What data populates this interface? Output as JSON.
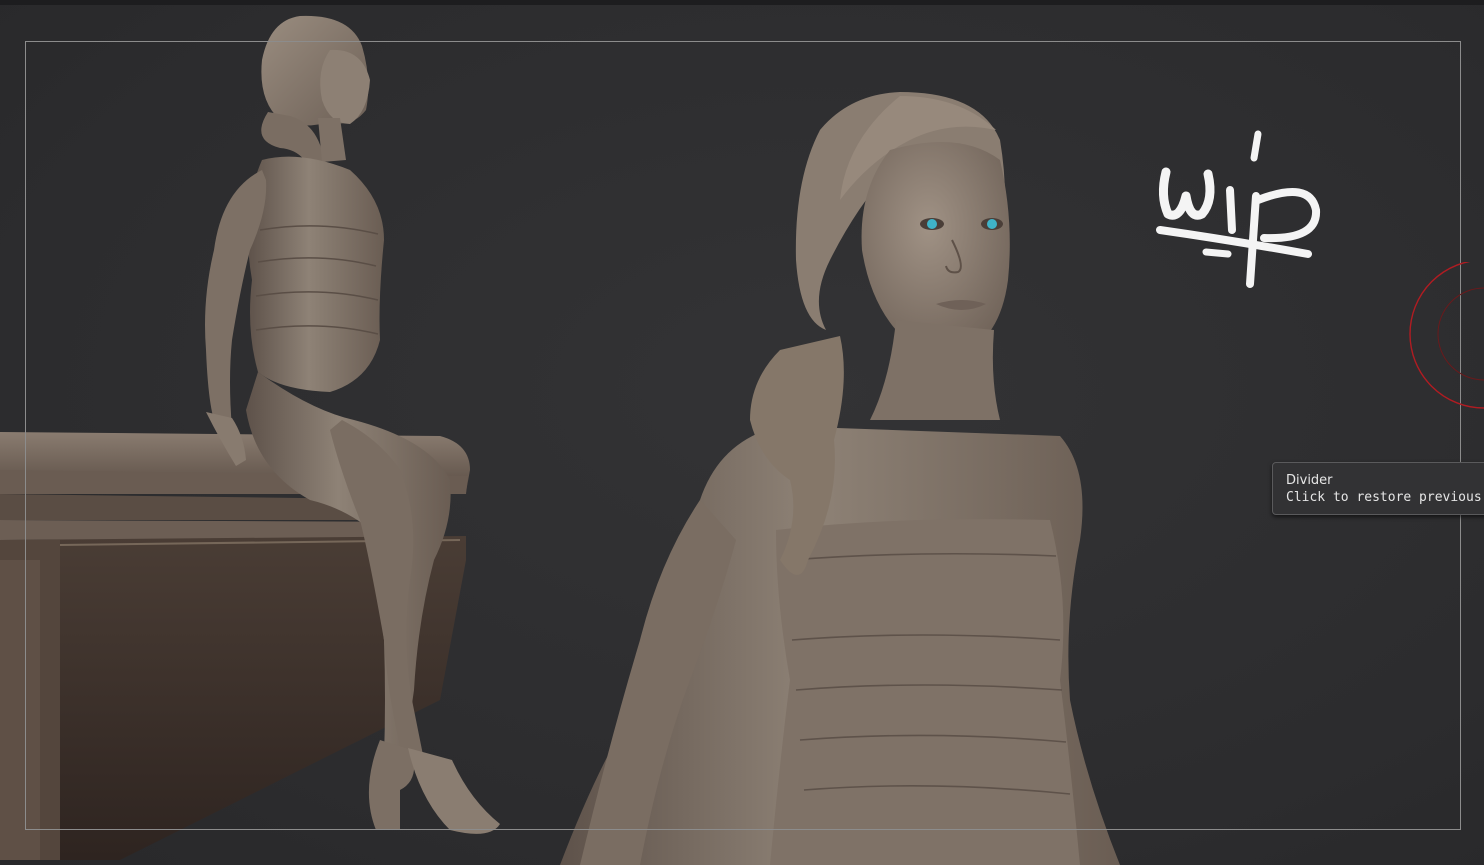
{
  "watermark": {
    "text": "wip"
  },
  "tooltip": {
    "title": "Divider",
    "description": "Click to restore previous po"
  },
  "colors": {
    "background": "#2d2d2f",
    "clay": "#8a7d72",
    "clay_dark": "#4a3c34",
    "eye": "#3fb3c8",
    "cursor_ring": "#b01c22"
  }
}
